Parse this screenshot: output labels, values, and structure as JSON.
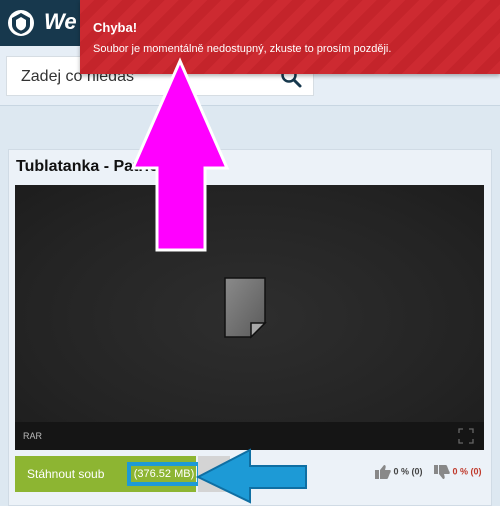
{
  "header": {
    "brand": "We"
  },
  "search": {
    "placeholder": "Zadej co hledáš"
  },
  "error": {
    "title": "Chyba!",
    "message": "Soubor je momentálně nedostupný, zkuste to prosím později."
  },
  "file": {
    "title": "Tublatanka - Patrio...).rar",
    "extension": "RAR"
  },
  "download": {
    "label": "Stáhnout soub",
    "size": "(376.52 MB)"
  },
  "votes": {
    "up": "0 % (0)",
    "down": "0 % (0)"
  },
  "colors": {
    "header": "#17384d",
    "error": "#cd2a31",
    "download": "#8db532",
    "highlight": "#1d9ad6",
    "arrow_magenta": "#ff00ff",
    "arrow_blue": "#1d9ad6"
  }
}
